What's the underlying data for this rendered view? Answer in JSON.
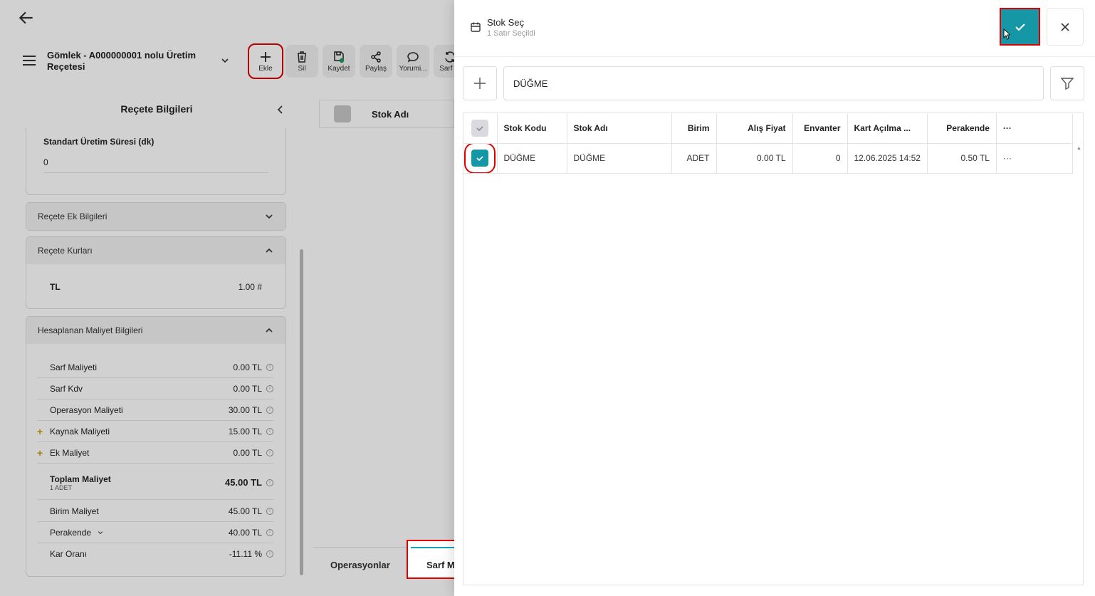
{
  "background": {
    "doc_title": "Gömlek - A000000001 nolu Üretim Reçetesi",
    "toolbar": [
      {
        "label": "Ekle",
        "icon": "plus-icon"
      },
      {
        "label": "Sil",
        "icon": "trash-icon"
      },
      {
        "label": "Kaydet",
        "icon": "save-icon"
      },
      {
        "label": "Paylaş",
        "icon": "share-icon"
      },
      {
        "label": "Yorumi...",
        "icon": "comment-icon"
      },
      {
        "label": "Sarf M",
        "icon": "refresh-icon"
      }
    ],
    "panel_title": "Reçete Bilgileri",
    "production_time": {
      "label": "Standart Üretim Süresi (dk)",
      "value": "0"
    },
    "sections": {
      "extra": "Reçete Ek Bilgileri",
      "rates": "Reçete Kurları",
      "costs": "Hesaplanan Maliyet Bilgileri"
    },
    "rate": {
      "currency": "TL",
      "value": "1.00 #"
    },
    "costs": [
      {
        "label": "Sarf Maliyeti",
        "value": "0.00 TL"
      },
      {
        "label": "Sarf Kdv",
        "value": "0.00 TL"
      },
      {
        "label": "Operasyon Maliyeti",
        "value": "30.00 TL"
      },
      {
        "label": "Kaynak Maliyeti",
        "value": "15.00 TL"
      },
      {
        "label": "Ek Maliyet",
        "value": "0.00 TL"
      },
      {
        "label": "Toplam Maliyet",
        "sub": "1 ADET",
        "value": "45.00 TL"
      },
      {
        "label": "Birim Maliyet",
        "value": "45.00 TL"
      },
      {
        "label": "Perakende",
        "value": "40.00 TL"
      },
      {
        "label": "Kar Oranı",
        "value": "-11.11 %"
      }
    ],
    "grid_col": "Stok Adı",
    "tabs": {
      "ops": "Operasyonlar",
      "sarf": "Sarf M"
    }
  },
  "drawer": {
    "title": "Stok Seç",
    "subtitle": "1 Satır Seçildi",
    "search_value": "DÜĞME",
    "columns": [
      "Stok Kodu",
      "Stok Adı",
      "Birim",
      "Alış Fiyat",
      "Envanter",
      "Kart Açılma ...",
      "Perakende",
      "···"
    ],
    "rows": [
      [
        "DÜĞME",
        "DÜĞME",
        "ADET",
        "0.00 TL",
        "0",
        "12.06.2025 14:52",
        "0.50 TL",
        "···"
      ]
    ],
    "colors": {
      "accent": "#1697a6",
      "highlight": "#e00000"
    }
  }
}
